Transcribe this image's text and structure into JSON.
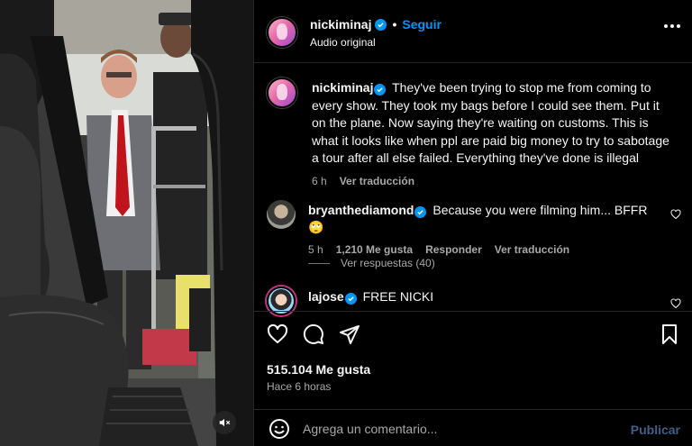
{
  "post": {
    "username": "nickiminaj",
    "follow_label": "Seguir",
    "separator": "•",
    "audio": "Audio original"
  },
  "caption": {
    "username": "nickiminaj",
    "text": "They've been trying to stop me from coming to every show. They took my bags before I could see them. Put it on the plane. Now saying they're waiting on customs. This is what it looks like when ppl are paid big money to try to sabotage a tour after all else failed. Everything they've done is illegal",
    "time": "6 h",
    "translate": "Ver traducción"
  },
  "comments": [
    {
      "username": "bryanthediamond",
      "text": "Because you were filming him... BFFR 🙄",
      "time": "5 h",
      "likes": "1,210 Me gusta",
      "reply": "Responder",
      "translate": "Ver traducción",
      "view_replies": "Ver respuestas (40)"
    },
    {
      "username": "lajose",
      "text": "FREE NICKI"
    }
  ],
  "actions": {
    "icons": [
      "heart-icon",
      "comment-icon",
      "share-icon",
      "bookmark-icon"
    ],
    "likes": "515.104 Me gusta",
    "time": "Hace 6 horas"
  },
  "composer": {
    "placeholder": "Agrega un comentario...",
    "publish_label": "Publicar"
  },
  "colors": {
    "accent": "#0095f6",
    "background": "#000000",
    "muted_text": "#a8a8a8",
    "publish_disabled": "#3f5f8a"
  }
}
